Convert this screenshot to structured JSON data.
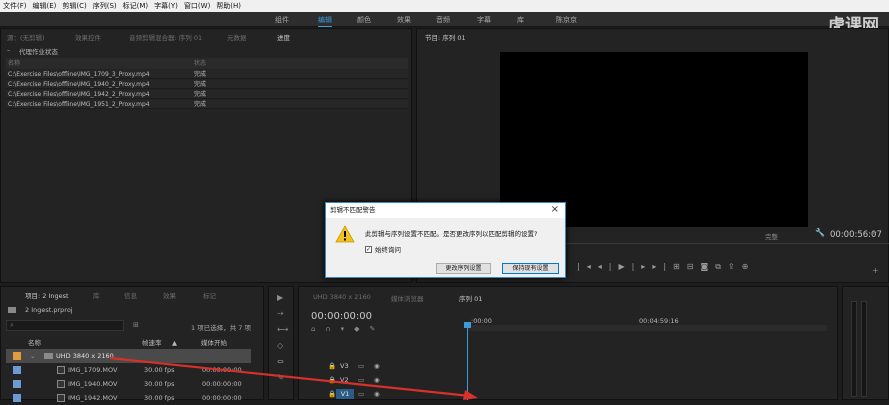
{
  "menu": [
    "文件(F)",
    "编辑(E)",
    "剪辑(C)",
    "序列(S)",
    "标记(M)",
    "字幕(Y)",
    "窗口(W)",
    "帮助(H)"
  ],
  "workspaces": [
    {
      "label": "组件",
      "active": false
    },
    {
      "label": "编辑",
      "active": true
    },
    {
      "label": "颜色",
      "active": false
    },
    {
      "label": "效果",
      "active": false
    },
    {
      "label": "音频",
      "active": false
    },
    {
      "label": "字幕",
      "active": false
    },
    {
      "label": "库",
      "active": false
    },
    {
      "label": "陈京京",
      "active": false
    }
  ],
  "logo": "虎课网",
  "top_left_tabs": [
    "源：(无剪辑)",
    "效果控件",
    "音频剪辑混合器: 序列 01",
    "元数据",
    "进度"
  ],
  "program_tab": "节目: 序列 01",
  "progress": {
    "title": "代理作业状态",
    "col_name": "名称",
    "col_status": "状态",
    "rows": [
      {
        "name": "C:\\Exercise Files\\offline\\IMG_1709_3_Proxy.mp4",
        "status": "完成"
      },
      {
        "name": "C:\\Exercise Files\\offline\\IMG_1940_2_Proxy.mp4",
        "status": "完成"
      },
      {
        "name": "C:\\Exercise Files\\offline\\IMG_1942_2_Proxy.mp4",
        "status": "完成"
      },
      {
        "name": "C:\\Exercise Files\\offline\\IMG_1951_2_Proxy.mp4",
        "status": "完成"
      }
    ]
  },
  "program": {
    "timecode": "00:00:56:07",
    "quality": "完整",
    "fit": "适合"
  },
  "dialog": {
    "title": "剪辑不匹配警告",
    "message": "此剪辑与序列设置不匹配。是否更改序列以匹配剪辑的设置?",
    "checkbox": "始终询问",
    "btn_change": "更改序列设置",
    "btn_keep": "保持现有设置"
  },
  "project": {
    "tabs": [
      "项目: 2 Ingest",
      "库",
      "信息",
      "效果",
      "标记"
    ],
    "file": "2 Ingest.prproj",
    "selection": "1 项已选择，共 7 项",
    "col_name": "名称",
    "col_fps": "帧速率",
    "col_start": "媒体开始",
    "items": [
      {
        "name": "UHD 3840 x 2160",
        "fps": "",
        "start": "",
        "kind": "folder"
      },
      {
        "name": "IMG_1709.MOV",
        "fps": "30.00 fps",
        "start": "00:00:00:00",
        "kind": "clip"
      },
      {
        "name": "IMG_1940.MOV",
        "fps": "30.00 fps",
        "start": "00:00:00:00",
        "kind": "clip"
      },
      {
        "name": "IMG_1942.MOV",
        "fps": "30.00 fps",
        "start": "00:00:00:00",
        "kind": "clip"
      }
    ]
  },
  "timeline": {
    "tabs": [
      "UHD 3840 x 2160",
      "媒体浏览器",
      "序列 01"
    ],
    "timecode": "00:00:00:00",
    "ruler_start": ":00:00",
    "ruler_mid": "00:04:59:16",
    "tracks": [
      "V3",
      "V2",
      "V1"
    ]
  },
  "colors": {
    "accent": "#3f9bd8",
    "arrow": "#d8302a",
    "folder_label": "#e59a3b",
    "clip_label": "#6c9ad5"
  }
}
